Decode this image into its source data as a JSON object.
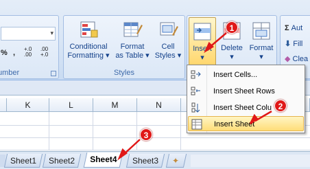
{
  "ribbon": {
    "number_group": {
      "label": "Number",
      "label_visible": "umber",
      "percent": "%",
      "comma": ",",
      "inc_decimal": "+.0 .00",
      "dec_decimal": ".00 +.0"
    },
    "styles_group": {
      "label": "Styles",
      "conditional_formatting": [
        "Conditional",
        "Formatting ▾"
      ],
      "format_as_table": [
        "Format",
        "as Table ▾"
      ],
      "cell_styles": [
        "Cell",
        "Styles ▾"
      ]
    },
    "cells_group": {
      "insert": "Insert",
      "delete": "Delete",
      "format": "Format",
      "dropdown": "▾"
    },
    "editing_group": {
      "autosum": "Aut",
      "fill": "Fill",
      "clear": "Clea"
    }
  },
  "menu": {
    "items": [
      {
        "label": "Insert Cells...",
        "icon": "insert-cells-icon"
      },
      {
        "label": "Insert Sheet Rows",
        "icon": "insert-rows-icon"
      },
      {
        "label": "Insert Sheet Colu",
        "icon": "insert-columns-icon"
      },
      {
        "label": "Insert Sheet",
        "icon": "insert-sheet-icon"
      }
    ]
  },
  "columns": [
    "K",
    "L",
    "M",
    "N"
  ],
  "tabs": [
    "Sheet1",
    "Sheet2",
    "Sheet4",
    "Sheet3"
  ],
  "active_tab": "Sheet4",
  "badges": [
    "1",
    "2",
    "3"
  ],
  "colors": {
    "ribbon_bg": "#d8e5f5",
    "hover_highlight": "#ffdd78",
    "badge_red": "#e01818",
    "arrow_red": "#e01818"
  }
}
